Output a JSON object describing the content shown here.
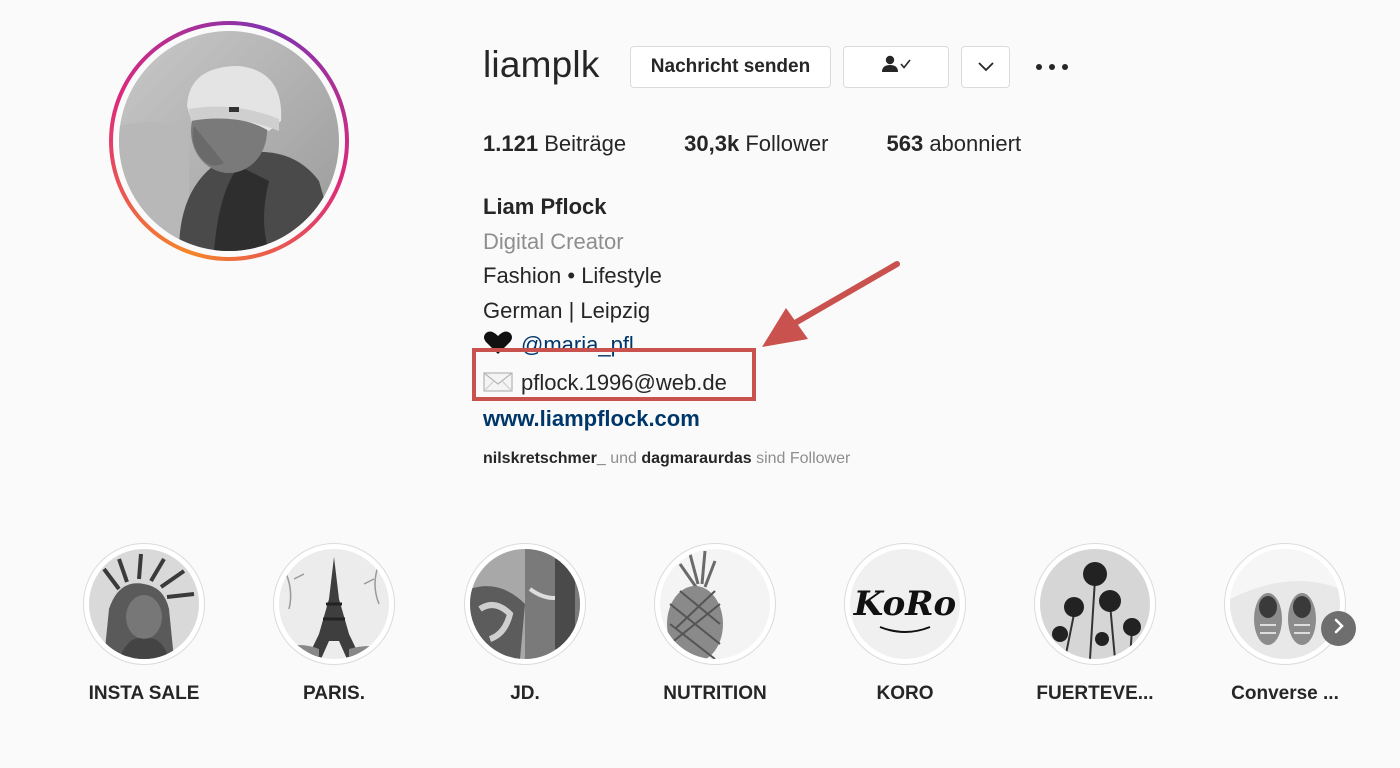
{
  "profile": {
    "username": "liamplk",
    "buttons": {
      "message": "Nachricht senden",
      "following_icon": "person-check-icon",
      "more_icon": "chevron-down-icon",
      "options_icon": "more-dots-icon"
    },
    "stats": {
      "posts_count": "1.121",
      "posts_label": "Beiträge",
      "followers_count": "30,3k",
      "followers_label": "Follower",
      "following_count": "563",
      "following_label": "abonniert"
    },
    "bio": {
      "name": "Liam Pflock",
      "category": "Digital Creator",
      "line1": "Fashion • Lifestyle",
      "line2": "German | Leipzig",
      "partner_icon": "black-heart-icon",
      "partner_handle": "@maria_pfl",
      "email_icon": "envelope-icon",
      "email": "pflock.1996@web.de",
      "website": "www.liampflock.com"
    },
    "followed_by": {
      "user1": "nilskretschmer_",
      "joiner": "und",
      "user2": "dagmaraurdas",
      "suffix": "sind Follower"
    }
  },
  "annotation": {
    "box_color": "#c9514e",
    "arrow_color": "#c9514e"
  },
  "highlights": [
    {
      "label": "INSTA SALE",
      "image": "statue-of-liberty"
    },
    {
      "label": "PARIS.",
      "image": "eiffel-tower"
    },
    {
      "label": "JD.",
      "image": "sneakers-box"
    },
    {
      "label": "NUTRITION",
      "image": "pineapple"
    },
    {
      "label": "KORO",
      "image": "koro-logo"
    },
    {
      "label": "FUERTEVE...",
      "image": "palm-trees"
    },
    {
      "label": "Converse ...",
      "image": "converse-shoes"
    }
  ],
  "highlights_nav_icon": "chevron-right-icon",
  "koro_logo_text": "KoRo"
}
